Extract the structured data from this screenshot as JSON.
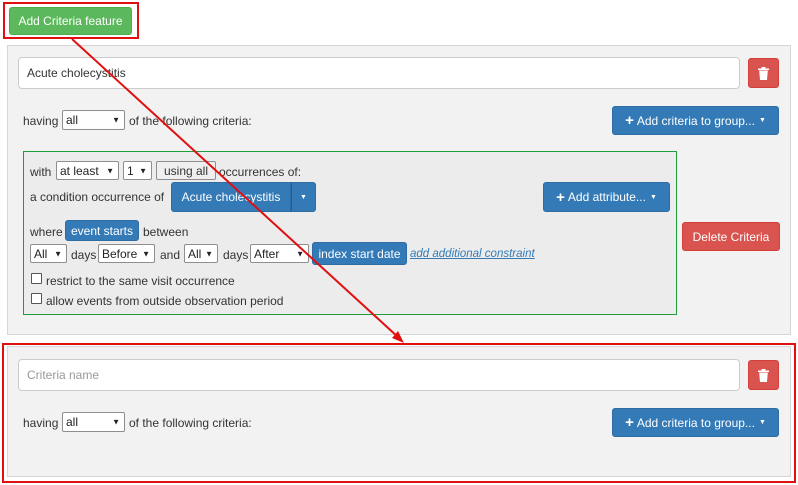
{
  "top": {
    "add_feature_label": "Add Criteria feature"
  },
  "group1": {
    "name_value": "Acute cholecystitis",
    "having_label": "having",
    "having_select": "all",
    "following_label": "of the following criteria:",
    "add_group_label": "Add criteria to group...",
    "delete_criteria_label": "Delete Criteria",
    "criterion": {
      "with_label": "with",
      "at_least_select": "at least",
      "count_select": "1",
      "using_all_label": "using all",
      "occurrences_label": "occurrences of:",
      "condition_label": "a condition occurrence of",
      "concept_label": "Acute cholecystitis",
      "add_attribute_label": "Add attribute...",
      "where_label": "where",
      "event_starts_label": "event starts",
      "between_label": "between",
      "days1_select": "All",
      "days_label": "days",
      "before_select": "Before",
      "and_label": "and",
      "days2_select": "All",
      "after_select": "After",
      "index_start_label": "index start date",
      "add_constraint_label": "add additional constraint",
      "restrict_label": "restrict to the same visit occurrence",
      "allow_label": "allow events from outside observation period"
    }
  },
  "group2": {
    "name_placeholder": "Criteria name",
    "having_label": "having",
    "having_select": "all",
    "following_label": "of the following criteria:",
    "add_group_label": "Add criteria to group..."
  },
  "colors": {
    "annotation_red": "#e01010",
    "primary_blue": "#337ab7",
    "success_green": "#5cb85c",
    "danger_red": "#d9534f",
    "criterion_border": "#1e9e3a"
  }
}
